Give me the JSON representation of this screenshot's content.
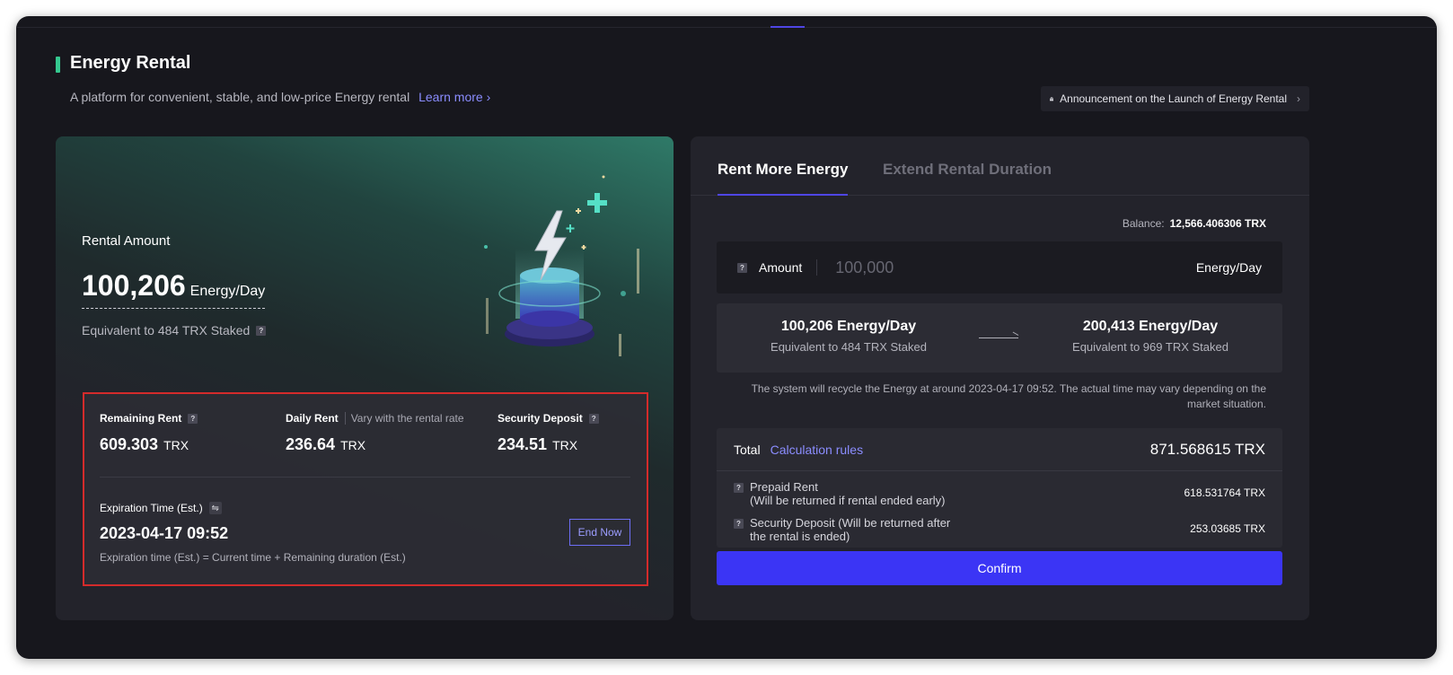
{
  "header": {
    "title": "Energy Rental",
    "subtitle": "A platform for convenient, stable, and low-price Energy rental",
    "learn_more": "Learn more",
    "announcement": "Announcement on the Launch of Energy Rental"
  },
  "rental": {
    "label": "Rental Amount",
    "value": "100,206",
    "unit": "Energy/Day",
    "equivalent": "Equivalent to 484 TRX Staked"
  },
  "details": {
    "remaining_rent_label": "Remaining Rent",
    "remaining_rent_value": "609.303",
    "daily_rent_label": "Daily Rent",
    "daily_rent_hint": "Vary with the rental rate",
    "daily_rent_value": "236.64",
    "security_deposit_label": "Security Deposit",
    "security_deposit_value": "234.51",
    "currency": "TRX",
    "expiration_label": "Expiration Time (Est.)",
    "expiration_value": "2023-04-17 09:52",
    "expiration_note": "Expiration time (Est.) = Current time + Remaining duration (Est.)",
    "end_now": "End Now"
  },
  "tabs": [
    "Rent More Energy",
    "Extend Rental Duration"
  ],
  "form": {
    "balance_label": "Balance:",
    "balance_value": "12,566.406306 TRX",
    "amount_label": "Amount",
    "amount_placeholder": "100,000",
    "amount_unit": "Energy/Day",
    "current_value": "100,206 Energy/Day",
    "current_equiv": "Equivalent to 484 TRX Staked",
    "new_value": "200,413 Energy/Day",
    "new_equiv": "Equivalent to 969 TRX Staked",
    "recycle_note": "The system will recycle the Energy at around 2023-04-17 09:52. The actual time may vary depending on the market situation.",
    "total_label": "Total",
    "calc_rules": "Calculation rules",
    "total_value": "871.568615 TRX",
    "prepaid_label_1": "Prepaid Rent",
    "prepaid_label_2": "(Will be returned if rental ended early)",
    "prepaid_value": "618.531764 TRX",
    "deposit_label_1": "Security Deposit (Will be returned after",
    "deposit_label_2": "the rental is ended)",
    "deposit_value": "253.03685 TRX",
    "confirm": "Confirm"
  },
  "colors": {
    "accent": "#3b35f5",
    "link": "#8b8dff",
    "green": "#35c88f",
    "highlight_border": "#d42b2b"
  }
}
